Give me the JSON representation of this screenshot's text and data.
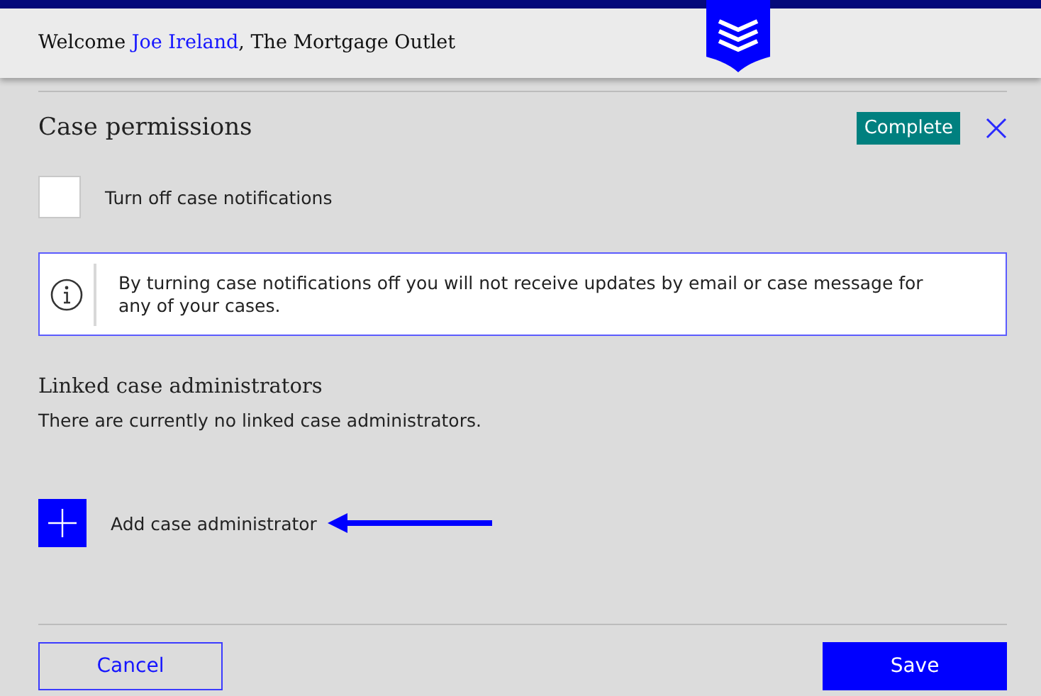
{
  "header": {
    "greeting": "Welcome",
    "user": "Joe Ireland",
    "company": ", The Mortgage Outlet"
  },
  "panel": {
    "title": "Case permissions",
    "status": "Complete",
    "notifications": {
      "label": "Turn off case notifications",
      "checked": false
    },
    "info": "By turning case notifications off you will not receive updates by email or case message for any of your cases.",
    "linked": {
      "heading": "Linked case administrators",
      "empty_text": "There are currently no linked case administrators.",
      "add_label": "Add case administrator"
    },
    "buttons": [
      {
        "label": "Cancel",
        "kind": "secondary"
      },
      {
        "label": "Save",
        "kind": "primary"
      }
    ]
  }
}
